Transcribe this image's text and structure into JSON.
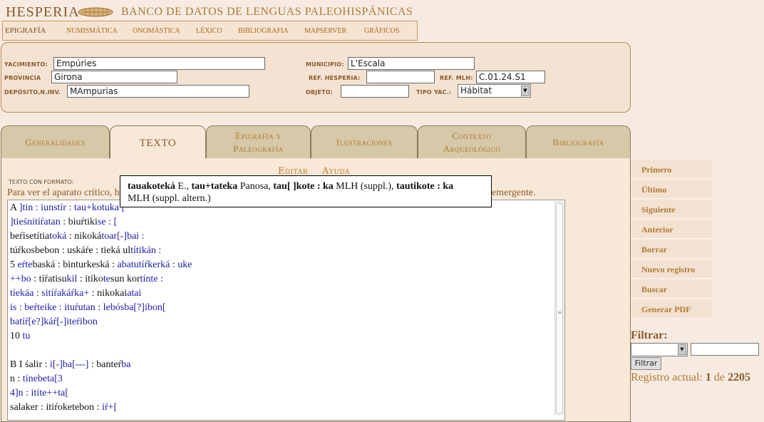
{
  "header": {
    "brand": "HESPERIA",
    "title": "BANCO DE DATOS DE LENGUAS PALEOHISPÁNICAS",
    "menu": [
      "EPIGRAFÍA",
      "NUMISMÁTICA",
      "ONOMÁSTICA",
      "LÉXICO",
      "BIBLIOGRAFIA",
      "MAPSERVER",
      "GRÁFICOS"
    ]
  },
  "fields": {
    "yacimiento_label": "YACIMIENTO:",
    "yacimiento": "Empúries",
    "provincia_label": "PROVINCIA",
    "provincia": "Girona",
    "deposito_label": "DEPÓSITO,N.INV.",
    "deposito": "MAmpurias",
    "municipio_label": "MUNICIPIO:",
    "municipio": "L'Escala",
    "ref_hesperia_label": "REF. HESPERIA:",
    "ref_hesperia": "",
    "ref_mlh_label": "REF. MLH:",
    "ref_mlh": "C.01.24.S1",
    "objeto_label": "OBJETO:",
    "objeto": "",
    "tipo_yac_label": "TIPO YAC.:",
    "tipo_yac": "Hábitat"
  },
  "tabs": [
    {
      "label": "Generalidades"
    },
    {
      "label": "TEXTO"
    },
    {
      "label": "Epigrafía y",
      "label2": "Paleografía"
    },
    {
      "label": "Ilustraciones"
    },
    {
      "label": "Contexto",
      "label2": "Arqueológico"
    },
    {
      "label": "Bibliografía"
    }
  ],
  "content": {
    "edit": "Editar",
    "help": "Ayuda",
    "format_label": "TEXTO CON FORMATO:",
    "note_start": "Para ver el aparato crítico, h",
    "note_end": "emergente."
  },
  "tooltip": {
    "line1_a": "tauakoteká",
    "line1_b": " E., ",
    "line1_c": "tau+tateka",
    "line1_d": " Panosa, ",
    "line1_e": "tau[ ]kote : ka",
    "line1_f": " MLH (suppl.), ",
    "line1_g": "tautikote : ka",
    "line2": "MLH (suppl. altern.)"
  },
  "text_lines": [
    [
      [
        "k",
        "A "
      ],
      [
        "b",
        "]tin : iunstír : tau+kotuka ["
      ]
    ],
    [
      [
        "b",
        "]tieśnitíŕatan"
      ],
      [
        "k",
        " : biuŕtiki"
      ],
      [
        "b",
        "se : ["
      ]
    ],
    [
      [
        "k",
        "beŕisetítia"
      ],
      [
        "b",
        "toká"
      ],
      [
        "k",
        " : nikoká"
      ],
      [
        "b",
        "toar[-]bai :"
      ]
    ],
    [
      [
        "k",
        "túŕkosbebon : uskáŕe : tieká ul"
      ],
      [
        "b",
        "títikán :"
      ]
    ],
    [
      [
        "k",
        "5 "
      ],
      [
        "b",
        "eŕte"
      ],
      [
        "k",
        "baská : binturkeská : "
      ],
      [
        "b",
        "abatutíŕkerká : uke"
      ]
    ],
    [
      [
        "b",
        "++bo"
      ],
      [
        "k",
        " : tíŕatisu"
      ],
      [
        "b",
        "kil"
      ],
      [
        "k",
        " : itíko"
      ],
      [
        "b",
        "te"
      ],
      [
        "k",
        "sun kor"
      ],
      [
        "b",
        "tínte :"
      ]
    ],
    [
      [
        "b",
        "tíekáa : sitíŕakáŕka+"
      ],
      [
        "k",
        " : nikokai"
      ],
      [
        "b",
        "atai"
      ]
    ],
    [
      [
        "b",
        "is : beŕteike : ituŕutan"
      ],
      [
        "k",
        " : "
      ],
      [
        "b",
        "lebósba[?]ibon["
      ]
    ],
    [
      [
        "b",
        "batíŕ[e?]káŕ[-]iteŕibon"
      ]
    ],
    [
      [
        "k",
        "10 "
      ],
      [
        "b",
        "tu"
      ]
    ],
    [],
    [
      [
        "k",
        "B I śalir : "
      ],
      [
        "b",
        "i[-]ba[---]"
      ],
      [
        "k",
        " : banteŕ"
      ],
      [
        "b",
        "ba"
      ]
    ],
    [
      [
        "k",
        "n : "
      ],
      [
        "b",
        "tínebeta[3"
      ]
    ],
    [
      [
        "b",
        "4]n : itíte++ta["
      ]
    ],
    [
      [
        "k",
        "salaker : itiŕoketebon : "
      ],
      [
        "b",
        "iŕ+["
      ]
    ]
  ],
  "nav": [
    "Primero",
    "Último",
    "Siguiente",
    "Anterior",
    "Borrar",
    "Nuevo registro",
    "Buscar",
    "Generar PDF"
  ],
  "filter": {
    "label": "Filtrar:",
    "button": "Filtrar",
    "status_prefix": "Registro actual: ",
    "current": "1",
    "of": " de ",
    "total": "2205"
  }
}
